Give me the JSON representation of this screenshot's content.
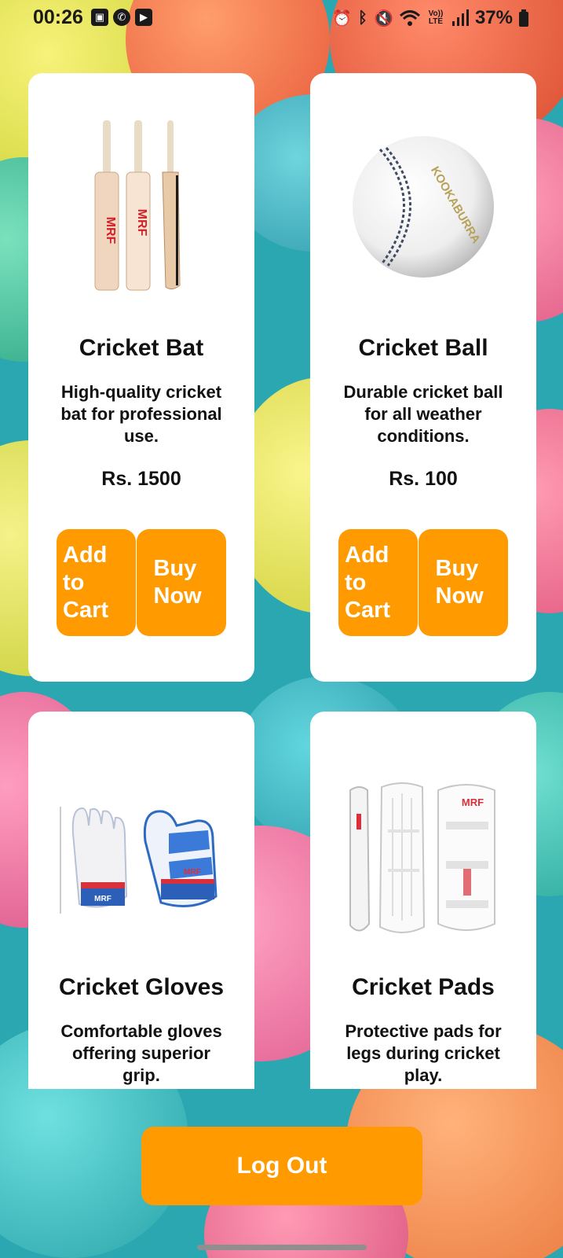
{
  "status_bar": {
    "time": "00:26",
    "left_icons": [
      "gallery-icon",
      "whatsapp-icon",
      "youtube-icon"
    ],
    "right_icons": [
      "alarm-icon",
      "bluetooth-icon",
      "mute-icon",
      "wifi-icon",
      "volte-icon",
      "signal-icon",
      "battery-icon"
    ],
    "volte_label": "Vo)) LTE",
    "battery": "37%"
  },
  "products": [
    {
      "name": "Cricket Bat",
      "description": "High-quality cricket bat for professional use.",
      "price": "Rs. 1500",
      "add_to_cart": "Add to Cart",
      "buy_now": "Buy Now",
      "image": "cricket-bat-image",
      "image_text": "MRF"
    },
    {
      "name": "Cricket Ball",
      "description": "Durable cricket ball for all weather conditions.",
      "price": "Rs. 100",
      "add_to_cart": "Add to Cart",
      "buy_now": "Buy Now",
      "image": "cricket-ball-image",
      "image_text": "KOOKABURRA"
    },
    {
      "name": "Cricket Gloves",
      "description": "Comfortable gloves offering superior grip.",
      "image": "cricket-gloves-image",
      "image_text": "MRF"
    },
    {
      "name": "Cricket Pads",
      "description": "Protective pads for legs during cricket play.",
      "image": "cricket-pads-image",
      "image_text": "MRF"
    }
  ],
  "logout_label": "Log Out",
  "colors": {
    "accent": "#ff9a00",
    "card": "#ffffff",
    "background": "#2aa7b0"
  }
}
